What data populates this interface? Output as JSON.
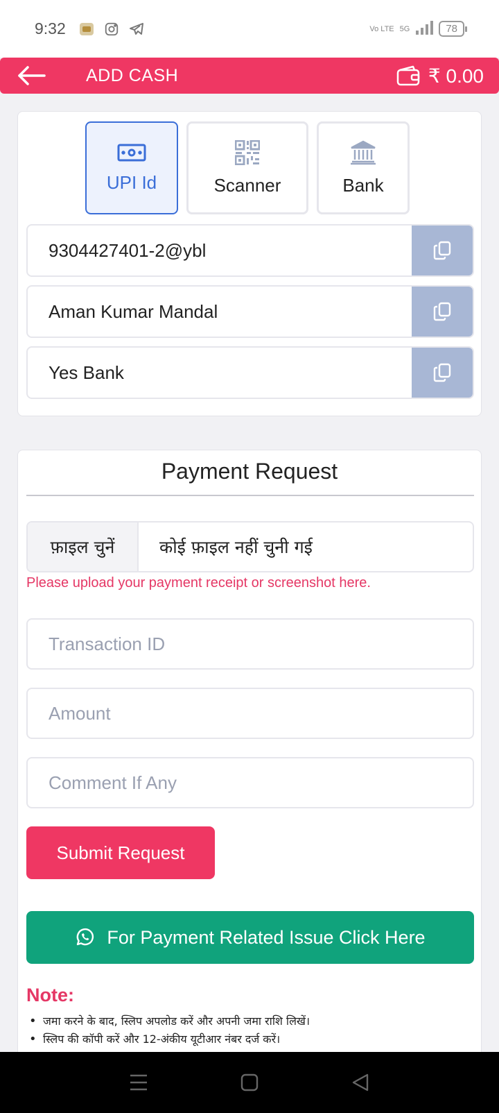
{
  "status_bar": {
    "time": "9:32",
    "network": "Vo LTE",
    "signal": "5G",
    "battery": "78"
  },
  "header": {
    "title": "ADD CASH",
    "balance": "₹ 0.00"
  },
  "tabs": [
    {
      "label": "UPI Id",
      "active": true
    },
    {
      "label": "Scanner",
      "active": false
    },
    {
      "label": "Bank",
      "active": false
    }
  ],
  "details": {
    "upi_id": "9304427401-2@ybl",
    "account_name": "Aman Kumar Mandal",
    "bank_name": "Yes Bank"
  },
  "payment_request": {
    "title": "Payment Request",
    "file_button": "फ़ाइल चुनें",
    "file_status": "कोई फ़ाइल नहीं चुनी गई",
    "upload_hint": "Please upload your payment receipt or screenshot here.",
    "transaction_placeholder": "Transaction ID",
    "amount_placeholder": "Amount",
    "comment_placeholder": "Comment If Any",
    "submit_label": "Submit Request",
    "support_label": "For Payment Related Issue Click Here"
  },
  "note": {
    "title": "Note:",
    "items": [
      "जमा करने के बाद, स्लिप अपलोड करें और अपनी जमा राशि लिखें।",
      "स्लिप की कॉपी करें और 12-अंकीय यूटीआर नंबर दर्ज करें।"
    ]
  },
  "colors": {
    "brand": "#ef3763",
    "accent_blue": "#3a6ed8",
    "whatsapp_green": "#10a37c",
    "copy_button": "#a8b7d5"
  }
}
